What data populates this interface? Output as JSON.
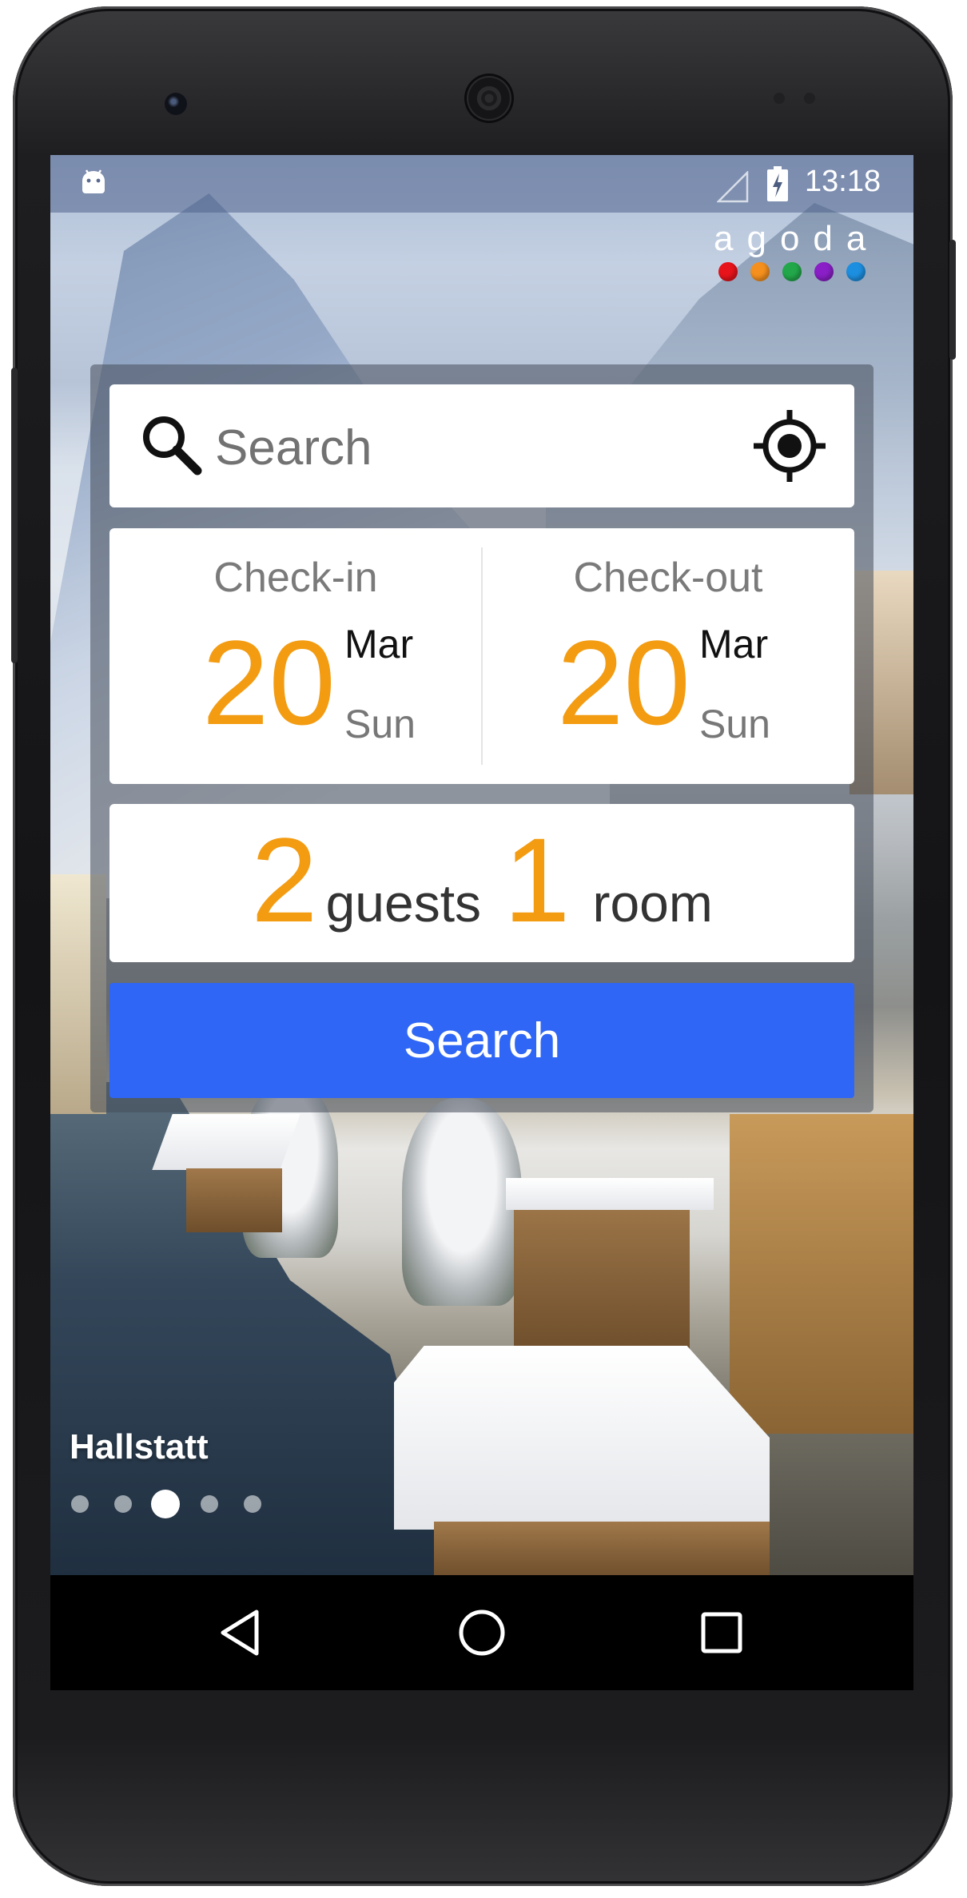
{
  "status_bar": {
    "time": "13:18",
    "icons": [
      "android-debug-icon",
      "signal-icon",
      "battery-charging-icon"
    ]
  },
  "brand": {
    "logo_text": "agoda",
    "dot_colors": [
      "#e8141b",
      "#f5901e",
      "#22a84a",
      "#8a1fc7",
      "#1d8fe0"
    ]
  },
  "search": {
    "placeholder": "Search",
    "value": "",
    "icons": [
      "search-icon",
      "locate-icon"
    ]
  },
  "checkin": {
    "label": "Check-in",
    "day": "20",
    "month": "Mar",
    "weekday": "Sun"
  },
  "checkout": {
    "label": "Check-out",
    "day": "20",
    "month": "Mar",
    "weekday": "Sun"
  },
  "occupancy": {
    "guests_count": "2",
    "guests_label": "guests",
    "rooms_count": "1",
    "rooms_label": "room"
  },
  "search_button": {
    "label": "Search"
  },
  "carousel": {
    "place_name": "Hallstatt",
    "page_count": 5,
    "active_index": 2
  },
  "nav_bar": {
    "icons": [
      "back-icon",
      "home-icon",
      "recents-icon"
    ]
  },
  "colors": {
    "accent_orange": "#f39c12",
    "button_blue": "#2f66f5"
  }
}
